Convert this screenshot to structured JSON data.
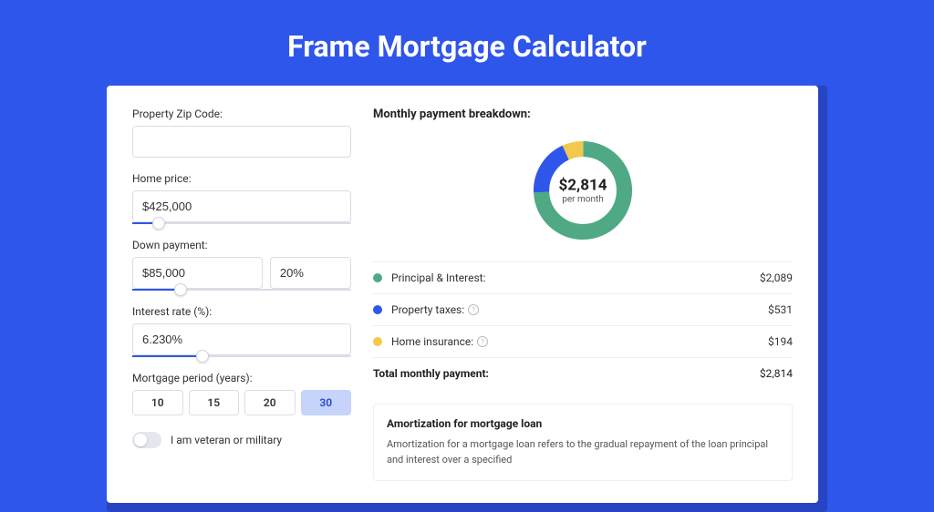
{
  "title": "Frame Mortgage Calculator",
  "form": {
    "zip": {
      "label": "Property Zip Code:",
      "value": ""
    },
    "home_price": {
      "label": "Home price:",
      "value": "$425,000",
      "slider_pct": 12
    },
    "down_payment": {
      "label": "Down payment:",
      "amount": "$85,000",
      "percent": "20%",
      "slider_pct": 22
    },
    "interest_rate": {
      "label": "Interest rate (%):",
      "value": "6.230%",
      "slider_pct": 32
    },
    "period": {
      "label": "Mortgage period (years):",
      "options": [
        "10",
        "15",
        "20",
        "30"
      ],
      "selected": "30"
    },
    "veteran": {
      "label": "I am veteran or military",
      "checked": false
    }
  },
  "breakdown": {
    "title": "Monthly payment breakdown:",
    "center_amount": "$2,814",
    "center_sub": "per month",
    "items": [
      {
        "label": "Principal & Interest:",
        "value": "$2,089",
        "color": "#4fa985"
      },
      {
        "label": "Property taxes:",
        "value": "$531",
        "color": "#2f56ea",
        "help": true
      },
      {
        "label": "Home insurance:",
        "value": "$194",
        "color": "#f2c94c",
        "help": true
      }
    ],
    "total_label": "Total monthly payment:",
    "total_value": "$2,814"
  },
  "amortization": {
    "title": "Amortization for mortgage loan",
    "text": "Amortization for a mortgage loan refers to the gradual repayment of the loan principal and interest over a specified"
  },
  "chart_data": {
    "type": "pie",
    "title": "Monthly payment breakdown",
    "series": [
      {
        "name": "Principal & Interest",
        "value": 2089,
        "color": "#4fa985"
      },
      {
        "name": "Property taxes",
        "value": 531,
        "color": "#2f56ea"
      },
      {
        "name": "Home insurance",
        "value": 194,
        "color": "#f2c94c"
      }
    ],
    "total": 2814,
    "center_label": "$2,814 per month"
  }
}
